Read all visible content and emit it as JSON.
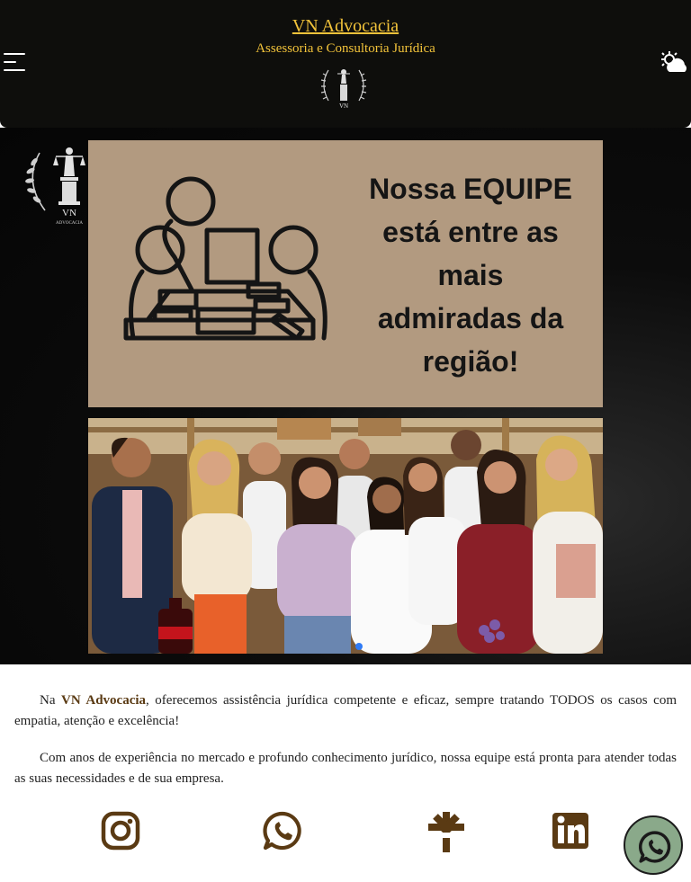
{
  "header": {
    "brand_title": "VN Advocacia",
    "brand_subtitle": "Assessoria e Consultoria Jurídica",
    "logo_caption": "VN",
    "menu_icon": "hamburger-menu-icon",
    "theme_icon": "sun-cloud-icon"
  },
  "hero": {
    "logo_text": "VN",
    "logo_subtext": "ADVOCACIA",
    "banner_line1": "Nossa EQUIPE",
    "banner_line2": "está entre as",
    "banner_line3": "mais",
    "banner_line4": "admiradas da",
    "banner_line5": "região!",
    "banner_illustration": "team-meeting-illustration",
    "photo_subject": "team-group-photo",
    "active_slide": 1
  },
  "intro": {
    "p1_prefix": "Na ",
    "p1_brand": "VN Advocacia",
    "p1_rest": ", oferecemos assistência jurídica competente e eficaz, sempre tratando TODOS os casos com empatia, atenção e excelência!",
    "p2": "Com anos de experiência no mercado e profundo conhecimento jurídico, nossa equipe está pronta para atender todas as suas necessidades e de sua empresa."
  },
  "social": {
    "items": [
      "instagram-icon",
      "whatsapp-icon",
      "linktree-icon",
      "linkedin-icon"
    ],
    "color": "#5a3a13"
  },
  "floating": {
    "icon": "whatsapp-icon",
    "background": "#8aa98a"
  },
  "colors": {
    "header_bg": "#0e0e0c",
    "accent_gold": "#f2c33a",
    "brand_brown": "#5a3a13",
    "banner_tan": "#b29a80"
  }
}
